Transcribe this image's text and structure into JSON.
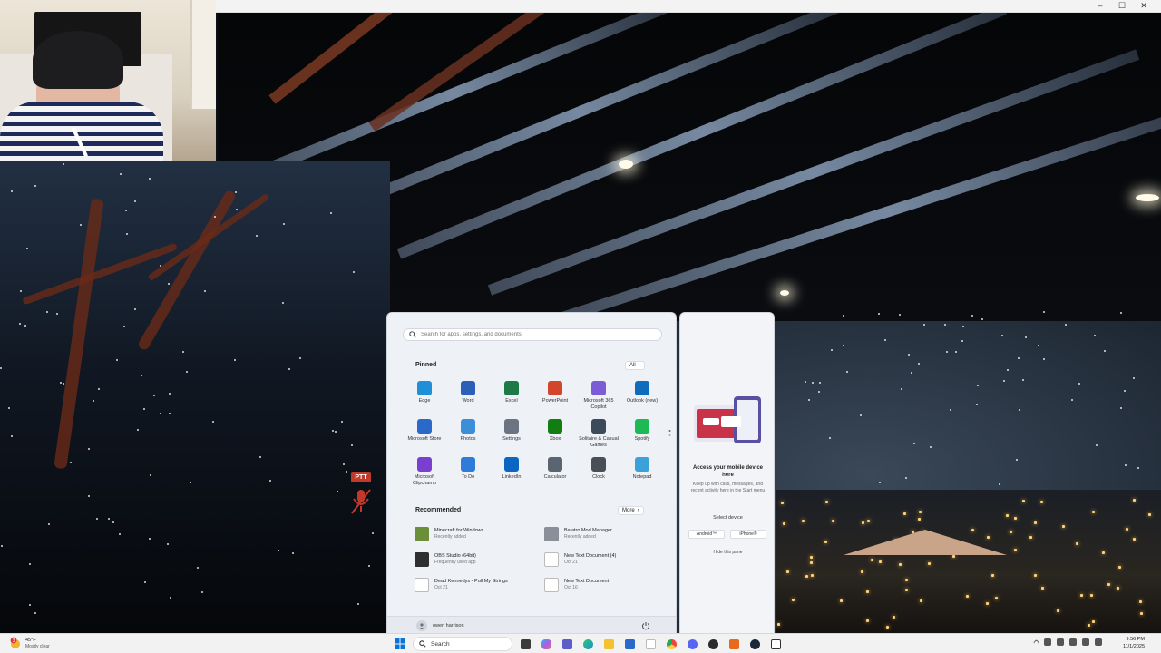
{
  "window": {
    "controls": [
      "–",
      "☐",
      "✕"
    ]
  },
  "overlay": {
    "ptt_label": "PTT"
  },
  "start_menu": {
    "search_placeholder": "Search for apps, settings, and documents",
    "pinned": {
      "title": "Pinned",
      "all_label": "All",
      "apps": [
        {
          "label": "Edge",
          "icon": "edge-icon",
          "color": "#1f8fd8"
        },
        {
          "label": "Word",
          "icon": "word-icon",
          "color": "#2b5fb8"
        },
        {
          "label": "Excel",
          "icon": "excel-icon",
          "color": "#1e7a45"
        },
        {
          "label": "PowerPoint",
          "icon": "powerpoint-icon",
          "color": "#d2472b"
        },
        {
          "label": "Microsoft 365 Copilot",
          "icon": "copilot-icon",
          "color": "#7c5cd6"
        },
        {
          "label": "Outlook (new)",
          "icon": "outlook-icon",
          "color": "#0f6cbd"
        },
        {
          "label": "Microsoft Store",
          "icon": "store-icon",
          "color": "#2a68c9"
        },
        {
          "label": "Photos",
          "icon": "photos-icon",
          "color": "#3a8fd8"
        },
        {
          "label": "Settings",
          "icon": "settings-icon",
          "color": "#6b7480"
        },
        {
          "label": "Xbox",
          "icon": "xbox-icon",
          "color": "#127d12"
        },
        {
          "label": "Solitaire & Casual Games",
          "icon": "solitaire-icon",
          "color": "#3d4a5a"
        },
        {
          "label": "Spotify",
          "icon": "spotify-icon",
          "color": "#1db954"
        },
        {
          "label": "Microsoft Clipchamp",
          "icon": "clipchamp-icon",
          "color": "#7b3fd0"
        },
        {
          "label": "To Do",
          "icon": "todo-icon",
          "color": "#2f7bd9"
        },
        {
          "label": "LinkedIn",
          "icon": "linkedin-icon",
          "color": "#0a66c2"
        },
        {
          "label": "Calculator",
          "icon": "calculator-icon",
          "color": "#5b6572"
        },
        {
          "label": "Clock",
          "icon": "clock-icon",
          "color": "#4a4f57"
        },
        {
          "label": "Notepad",
          "icon": "notepad-icon",
          "color": "#3aa2d9"
        }
      ]
    },
    "recommended": {
      "title": "Recommended",
      "more_label": "More",
      "items": [
        {
          "name": "Minecraft for Windows",
          "sub": "Recently added",
          "icon": "minecraft-icon",
          "color": "#6b8e3a"
        },
        {
          "name": "Balatro Mod Manager",
          "sub": "Recently added",
          "icon": "balatro-icon",
          "color": "#8a8f99"
        },
        {
          "name": "OBS Studio (64bit)",
          "sub": "Frequently used app",
          "icon": "obs-icon",
          "color": "#302e31"
        },
        {
          "name": "New Text Document (4)",
          "sub": "Oct 21",
          "icon": "text-file-icon",
          "color": "#ffffff"
        },
        {
          "name": "Dead Kennedys - Pull My Strings",
          "sub": "Oct 21",
          "icon": "media-file-icon",
          "color": "#ffffff"
        },
        {
          "name": "New Text Document",
          "sub": "Oct 16",
          "icon": "text-doc-icon",
          "color": "#ffffff"
        }
      ]
    },
    "user": {
      "name": "owen harrison"
    }
  },
  "phone_panel": {
    "title": "Access your mobile device here",
    "desc": "Keep up with calls, messages, and recent activity here in the Start menu",
    "select_label": "Select device",
    "android_label": "Android™",
    "iphone_label": "iPhone®",
    "hide_label": "Hide this pane"
  },
  "taskbar": {
    "weather": {
      "temp": "45°F",
      "condition": "Mostly clear",
      "badge": "3"
    },
    "search_label": "Search",
    "time": "9:56 PM",
    "date": "11/1/2025"
  }
}
